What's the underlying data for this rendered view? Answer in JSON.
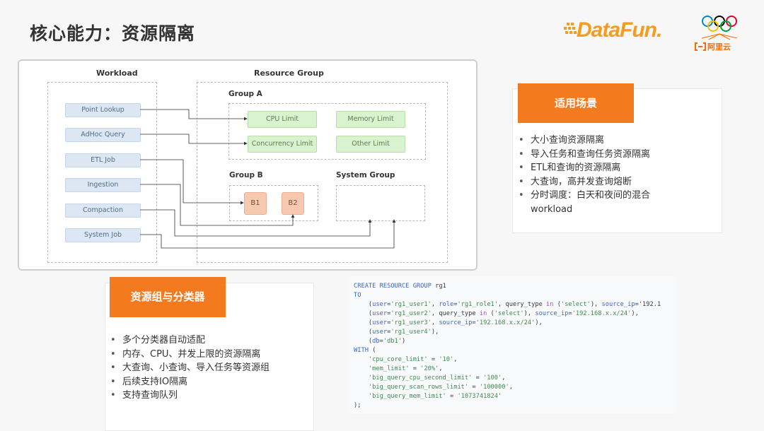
{
  "page": {
    "title": "核心能力：资源隔离"
  },
  "logos": {
    "datafun": "DataFun.",
    "aliyun": "阿里云"
  },
  "diagram": {
    "workload_title": "Workload",
    "resource_group_title": "Resource Group",
    "workloads": [
      "Point Lookup",
      "AdHoc Query",
      "ETL Job",
      "Ingestion",
      "Compaction",
      "System Job"
    ],
    "group_a": {
      "title": "Group A",
      "limits": [
        "CPU Limit",
        "Memory Limit",
        "Concurrency Limit",
        "Other Limit"
      ]
    },
    "group_b": {
      "title": "Group B",
      "nodes": [
        "B1",
        "B2"
      ]
    },
    "system_group": {
      "title": "System Group"
    }
  },
  "scenarios": {
    "title": "适用场景",
    "items": [
      "大小查询资源隔离",
      "导入任务和查询任务资源隔离",
      "ETL和查询的资源隔离",
      "大查询，高并发查询熔断",
      "分时调度：白天和夜间的混合",
      "workload"
    ]
  },
  "classifier": {
    "title": "资源组与分类器",
    "items": [
      "多个分类器自动适配",
      "内存、CPU、并发上限的资源隔离",
      "大查询、小查询、导入任务等资源组",
      "后续支持IO隔离",
      "支持查询队列"
    ]
  },
  "code_lines": [
    "CREATE RESOURCE GROUP rg1",
    "TO",
    "    (user='rg1_user1', role='rg1_role1', query_type in ('select'), source_ip='192.1",
    "    (user='rg1_user2', query_type in ('select'), source_ip='192.168.x.x/24'),",
    "    (user='rg1_user3', source_ip='192.168.x.x/24'),",
    "    (user='rg1_user4'),",
    "    (db='db1')",
    "WITH (",
    "    'cpu_core_limit' = '10',",
    "    'mem_limit' = '20%',",
    "    'big_query_cpu_second_limit' = '100',",
    "    'big_query_scan_rows_limit' = '100000',",
    "    'big_query_mem_limit' = '1073741824'",
    ");"
  ]
}
